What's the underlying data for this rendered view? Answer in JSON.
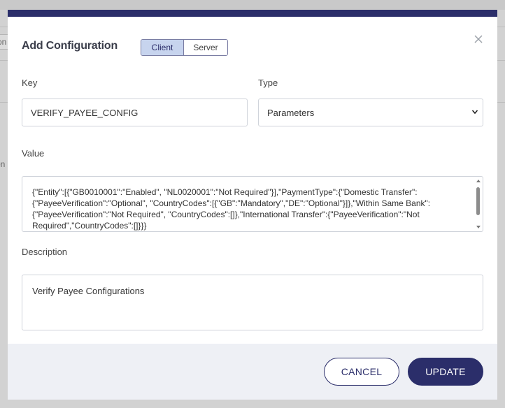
{
  "background": {
    "field_fragment": "on",
    "text_fragment": "on"
  },
  "modal": {
    "title": "Add Configuration",
    "toggle": {
      "client_label": "Client",
      "server_label": "Server",
      "selected": "Client"
    },
    "key": {
      "label": "Key",
      "value": "VERIFY_PAYEE_CONFIG"
    },
    "type": {
      "label": "Type",
      "value": "Parameters"
    },
    "value": {
      "label": "Value",
      "text": "{\"Entity\":[{\"GB0010001\":\"Enabled\", \"NL0020001\":\"Not Required\"}],\"PaymentType\":{\"Domestic Transfer\":{\"PayeeVerification\":\"Optional\", \"CountryCodes\":[{\"GB\":\"Mandatory\",\"DE\":\"Optional\"}]},\"Within Same Bank\":{\"PayeeVerification\":\"Not Required\", \"CountryCodes\":[]},\"International Transfer\":{\"PayeeVerification\":\"Not Required\",\"CountryCodes\":[]}}}"
    },
    "description": {
      "label": "Description",
      "value": "Verify Payee Configurations"
    },
    "buttons": {
      "cancel": "CANCEL",
      "update": "UPDATE"
    }
  },
  "colors": {
    "brand": "#2b2e6a",
    "toggle_selected": "#c7d4ee",
    "footer_bg": "#eef0f5"
  },
  "icons": {
    "close": "close-icon",
    "select_chevron": "chevron-down-icon",
    "scroll_up": "caret-up-icon",
    "scroll_down": "caret-down-icon"
  }
}
